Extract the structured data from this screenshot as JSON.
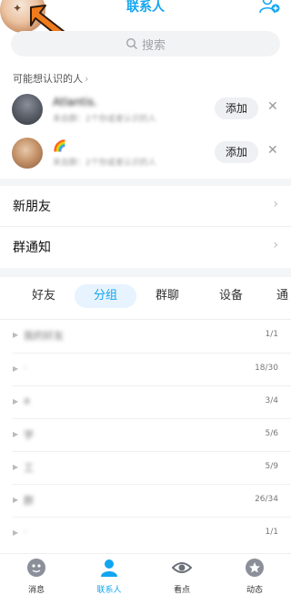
{
  "header": {
    "title": "联系人"
  },
  "search": {
    "placeholder": "搜索"
  },
  "may_know": {
    "title": "可能想认识的人",
    "items": [
      {
        "name": "Atlantis.",
        "subtitle": "来自群：2个你或者认识的人",
        "add_label": "添加"
      },
      {
        "name": "🌈",
        "subtitle": "来自群：2个你或者认识的人",
        "add_label": "添加"
      }
    ]
  },
  "nav_rows": [
    {
      "label": "新朋友"
    },
    {
      "label": "群通知"
    }
  ],
  "tabs": [
    {
      "label": "好友"
    },
    {
      "label": "分组"
    },
    {
      "label": "群聊"
    },
    {
      "label": "设备"
    },
    {
      "label": "通"
    }
  ],
  "groups": [
    {
      "name": "我的好友",
      "count": "1/1"
    },
    {
      "name": "·",
      "count": "18/30"
    },
    {
      "name": "a",
      "count": "3/4"
    },
    {
      "name": "学",
      "count": "5/6"
    },
    {
      "name": "工",
      "count": "5/9"
    },
    {
      "name": "群",
      "count": "26/34"
    },
    {
      "name": "·",
      "count": "1/1"
    }
  ],
  "bottom_nav": [
    {
      "label": "消息",
      "icon": "message-icon"
    },
    {
      "label": "联系人",
      "icon": "contacts-icon"
    },
    {
      "label": "看点",
      "icon": "watch-icon"
    },
    {
      "label": "动态",
      "icon": "star-icon"
    }
  ],
  "colors": {
    "accent": "#12a5f0",
    "arrow": "#ef7b1b"
  }
}
